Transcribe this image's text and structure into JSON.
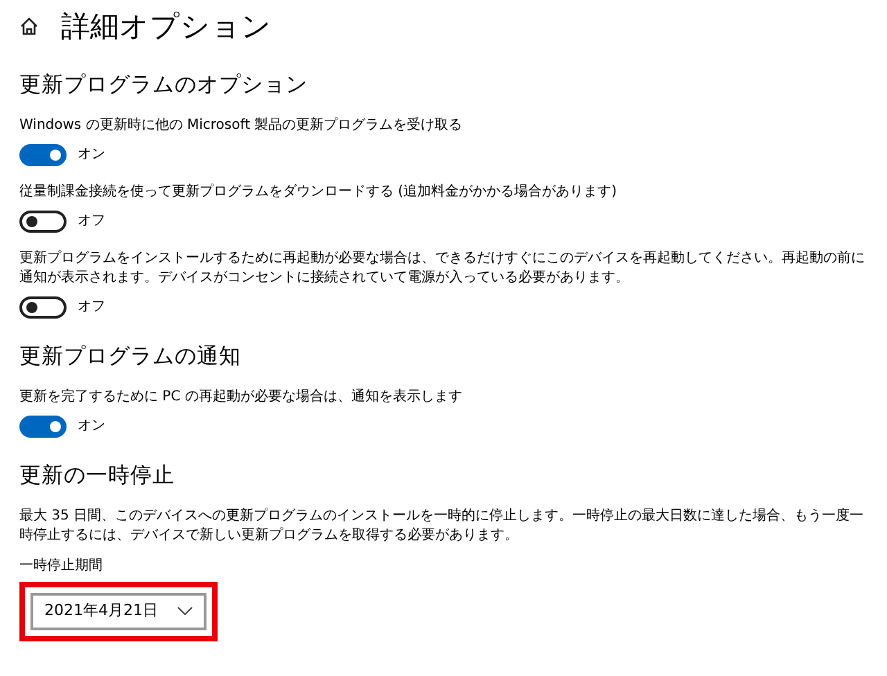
{
  "header": {
    "title": "詳細オプション"
  },
  "sections": [
    {
      "heading": "更新プログラムのオプション",
      "items": [
        {
          "kind": "toggle",
          "label": "Windows の更新時に他の Microsoft 製品の更新プログラムを受け取る",
          "on": true,
          "state_text": "オン"
        },
        {
          "kind": "toggle",
          "label": "従量制課金接続を使って更新プログラムをダウンロードする (追加料金がかかる場合があります)",
          "on": false,
          "state_text": "オフ"
        },
        {
          "kind": "toggle",
          "label": "更新プログラムをインストールするために再起動が必要な場合は、できるだけすぐにこのデバイスを再起動してください。再起動の前に通知が表示されます。デバイスがコンセントに接続されていて電源が入っている必要があります。",
          "on": false,
          "state_text": "オフ"
        }
      ]
    },
    {
      "heading": "更新プログラムの通知",
      "items": [
        {
          "kind": "toggle",
          "label": "更新を完了するために PC の再起動が必要な場合は、通知を表示します",
          "on": true,
          "state_text": "オン"
        }
      ]
    },
    {
      "heading": "更新の一時停止",
      "items": [
        {
          "kind": "paragraph",
          "text": "最大 35 日間、このデバイスへの更新プログラムのインストールを一時的に停止します。一時停止の最大日数に達した場合、もう一度一時停止するには、デバイスで新しい更新プログラムを取得する必要があります。"
        },
        {
          "kind": "dropdown",
          "label": "一時停止期間",
          "value": "2021年4月21日",
          "highlighted": true
        }
      ]
    }
  ]
}
